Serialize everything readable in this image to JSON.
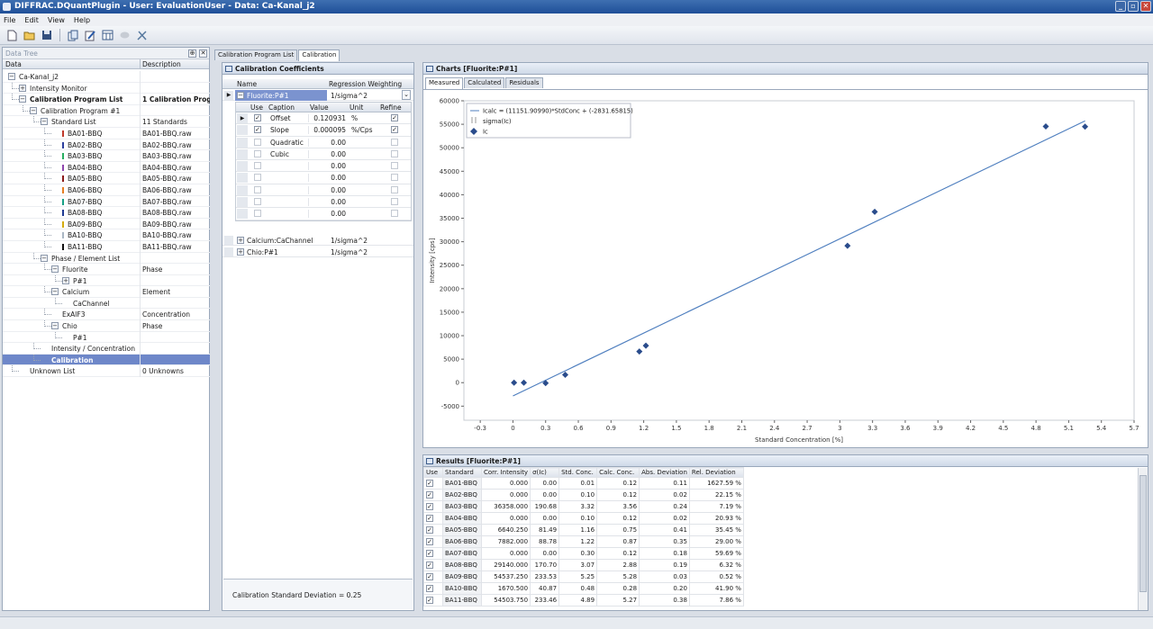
{
  "window": {
    "title": "DIFFRAC.DQuantPlugin - User: EvaluationUser - Data: Ca-Kanal_j2"
  },
  "menu": [
    "File",
    "Edit",
    "View",
    "Help"
  ],
  "toolbar_icons": [
    "new-file-icon",
    "open-folder-icon",
    "save-icon",
    "copy-icon",
    "edit-icon",
    "table-icon",
    "disabled-icon",
    "settings-icon"
  ],
  "data_tree": {
    "title": "Data Tree",
    "col_data": "Data",
    "col_desc": "Description",
    "rows": [
      {
        "label": "Ca-Kanal_j2",
        "desc": "",
        "level": 0,
        "expander": "-",
        "bold": false,
        "swatch": ""
      },
      {
        "label": "Intensity Monitor",
        "desc": "",
        "level": 1,
        "expander": "+",
        "bold": false,
        "swatch": ""
      },
      {
        "label": "Calibration Program List",
        "desc": "1 Calibration Prog...",
        "level": 1,
        "expander": "-",
        "bold": true,
        "swatch": ""
      },
      {
        "label": "Calibration Program #1",
        "desc": "",
        "level": 2,
        "expander": "-",
        "bold": false,
        "swatch": ""
      },
      {
        "label": "Standard List",
        "desc": "11 Standards",
        "level": 3,
        "expander": "-",
        "bold": false,
        "swatch": ""
      },
      {
        "label": "BA01-BBQ",
        "desc": "BA01-BBQ.raw",
        "level": 4,
        "expander": "",
        "bold": false,
        "swatch": "#c0392b"
      },
      {
        "label": "BA02-BBQ",
        "desc": "BA02-BBQ.raw",
        "level": 4,
        "expander": "",
        "bold": false,
        "swatch": "#2c3e9e"
      },
      {
        "label": "BA03-BBQ",
        "desc": "BA03-BBQ.raw",
        "level": 4,
        "expander": "",
        "bold": false,
        "swatch": "#27ae60"
      },
      {
        "label": "BA04-BBQ",
        "desc": "BA04-BBQ.raw",
        "level": 4,
        "expander": "",
        "bold": false,
        "swatch": "#8e44ad"
      },
      {
        "label": "BA05-BBQ",
        "desc": "BA05-BBQ.raw",
        "level": 4,
        "expander": "",
        "bold": false,
        "swatch": "#8b1a1a"
      },
      {
        "label": "BA06-BBQ",
        "desc": "BA06-BBQ.raw",
        "level": 4,
        "expander": "",
        "bold": false,
        "swatch": "#e67e22"
      },
      {
        "label": "BA07-BBQ",
        "desc": "BA07-BBQ.raw",
        "level": 4,
        "expander": "",
        "bold": false,
        "swatch": "#16a085"
      },
      {
        "label": "BA08-BBQ",
        "desc": "BA08-BBQ.raw",
        "level": 4,
        "expander": "",
        "bold": false,
        "swatch": "#1f3a93"
      },
      {
        "label": "BA09-BBQ",
        "desc": "BA09-BBQ.raw",
        "level": 4,
        "expander": "",
        "bold": false,
        "swatch": "#d4ac0d"
      },
      {
        "label": "BA10-BBQ",
        "desc": "BA10-BBQ.raw",
        "level": 4,
        "expander": "",
        "bold": false,
        "swatch": "#aab7c4"
      },
      {
        "label": "BA11-BBQ",
        "desc": "BA11-BBQ.raw",
        "level": 4,
        "expander": "",
        "bold": false,
        "swatch": "#111111"
      },
      {
        "label": "Phase / Element List",
        "desc": "",
        "level": 3,
        "expander": "-",
        "bold": false,
        "swatch": ""
      },
      {
        "label": "Fluorite",
        "desc": "Phase",
        "level": 4,
        "expander": "-",
        "bold": false,
        "swatch": ""
      },
      {
        "label": "P#1",
        "desc": "",
        "level": 5,
        "expander": "+",
        "bold": false,
        "swatch": ""
      },
      {
        "label": "Calcium",
        "desc": "Element",
        "level": 4,
        "expander": "-",
        "bold": false,
        "swatch": ""
      },
      {
        "label": "CaChannel",
        "desc": "",
        "level": 5,
        "expander": "",
        "bold": false,
        "swatch": ""
      },
      {
        "label": "ExAlF3",
        "desc": "Concentration",
        "level": 4,
        "expander": "",
        "bold": false,
        "swatch": ""
      },
      {
        "label": "Chio",
        "desc": "Phase",
        "level": 4,
        "expander": "-",
        "bold": false,
        "swatch": ""
      },
      {
        "label": "P#1",
        "desc": "",
        "level": 5,
        "expander": "",
        "bold": false,
        "swatch": ""
      },
      {
        "label": "Intensity / Concentration",
        "desc": "",
        "level": 3,
        "expander": "",
        "bold": false,
        "swatch": ""
      },
      {
        "label": "Calibration",
        "desc": "",
        "level": 3,
        "expander": "",
        "bold": true,
        "swatch": "",
        "selected": true
      },
      {
        "label": "Unknown List",
        "desc": "0 Unknowns",
        "level": 1,
        "expander": "",
        "bold": false,
        "swatch": ""
      }
    ]
  },
  "doc_tabs": [
    "Calibration Program List",
    "Calibration"
  ],
  "coefficients": {
    "title": "Calibration Coefficients",
    "col_name": "Name",
    "col_weighting": "Regression Weighting",
    "groups": [
      {
        "name": "Fluorite:P#1",
        "weighting": "1/sigma^2"
      },
      {
        "name": "Calcium:CaChannel",
        "weighting": "1/sigma^2"
      },
      {
        "name": "Chio:P#1",
        "weighting": "1/sigma^2"
      }
    ],
    "sub_headers": [
      "Use",
      "Caption",
      "Value",
      "Unit",
      "Refine"
    ],
    "rows": [
      {
        "use": true,
        "caption": "Offset",
        "value": "0.120931",
        "unit": "%",
        "refine": true
      },
      {
        "use": true,
        "caption": "Slope",
        "value": "0.000095",
        "unit": "%/Cps",
        "refine": true
      },
      {
        "use": false,
        "caption": "Quadratic",
        "value": "0.00",
        "unit": "",
        "refine": false
      },
      {
        "use": false,
        "caption": "Cubic",
        "value": "0.00",
        "unit": "",
        "refine": false
      },
      {
        "use": false,
        "caption": "",
        "value": "0.00",
        "unit": "",
        "refine": false
      },
      {
        "use": false,
        "caption": "",
        "value": "0.00",
        "unit": "",
        "refine": false
      },
      {
        "use": false,
        "caption": "",
        "value": "0.00",
        "unit": "",
        "refine": false
      },
      {
        "use": false,
        "caption": "",
        "value": "0.00",
        "unit": "",
        "refine": false
      },
      {
        "use": false,
        "caption": "",
        "value": "0.00",
        "unit": "",
        "refine": false
      }
    ],
    "std_dev": "Calibration Standard Deviation = 0.25"
  },
  "charts": {
    "title": "Charts [Fluorite:P#1]",
    "tabs": [
      "Measured",
      "Calculated",
      "Residuals"
    ]
  },
  "chart_data": {
    "type": "scatter",
    "xlabel": "Standard Concentration [%]",
    "ylabel": "Intensity [cps]",
    "xlim": [
      -0.45,
      5.7
    ],
    "ylim": [
      -8000,
      60000
    ],
    "xticks": [
      "-0.3",
      "0",
      "0.3",
      "0.6",
      "0.9",
      "1.2",
      "1.5",
      "1.8",
      "2.1",
      "2.4",
      "2.7",
      "3",
      "3.3",
      "3.6",
      "3.9",
      "4.2",
      "4.5",
      "4.8",
      "5.1",
      "5.4",
      "5.7"
    ],
    "yticks": [
      "-5000",
      "0",
      "5000",
      "10000",
      "15000",
      "20000",
      "25000",
      "30000",
      "35000",
      "40000",
      "45000",
      "50000",
      "55000",
      "60000"
    ],
    "legend": {
      "position": "top-left",
      "entries": [
        "Icalc = (11151.90990)*StdConc + (-2831.65815)",
        "sigma(Ic)",
        "Ic"
      ]
    },
    "fit_line": {
      "slope": 11151.9099,
      "intercept": -2831.65815,
      "x": [
        0.0,
        5.25
      ]
    },
    "series": [
      {
        "name": "Ic",
        "x": [
          0.01,
          0.1,
          0.3,
          0.48,
          1.16,
          1.22,
          3.07,
          3.32,
          4.89,
          5.25
        ],
        "y": [
          0,
          0,
          -100,
          1670,
          6640,
          7882,
          29140,
          36358,
          54537,
          54504
        ]
      }
    ],
    "grid": true,
    "colors": {
      "line": "#4f7fbf",
      "marker": "#2a4c8c"
    }
  },
  "results": {
    "title": "Results [Fluorite:P#1]",
    "headers": [
      "Use",
      "Standard",
      "Corr. Intensity",
      "σ(Ic)",
      "Std. Conc.",
      "Calc. Conc.",
      "Abs. Deviation",
      "Rel. Deviation"
    ],
    "rows": [
      {
        "use": true,
        "standard": "BA01-BBQ",
        "corr": "0.000",
        "sigma": "0.00",
        "std": "0.01",
        "calc": "0.12",
        "abs": "0.11",
        "rel": "1627.59 %"
      },
      {
        "use": true,
        "standard": "BA02-BBQ",
        "corr": "0.000",
        "sigma": "0.00",
        "std": "0.10",
        "calc": "0.12",
        "abs": "0.02",
        "rel": "22.15 %"
      },
      {
        "use": true,
        "standard": "BA03-BBQ",
        "corr": "36358.000",
        "sigma": "190.68",
        "std": "3.32",
        "calc": "3.56",
        "abs": "0.24",
        "rel": "7.19 %"
      },
      {
        "use": true,
        "standard": "BA04-BBQ",
        "corr": "0.000",
        "sigma": "0.00",
        "std": "0.10",
        "calc": "0.12",
        "abs": "0.02",
        "rel": "20.93 %"
      },
      {
        "use": true,
        "standard": "BA05-BBQ",
        "corr": "6640.250",
        "sigma": "81.49",
        "std": "1.16",
        "calc": "0.75",
        "abs": "0.41",
        "rel": "35.45 %"
      },
      {
        "use": true,
        "standard": "BA06-BBQ",
        "corr": "7882.000",
        "sigma": "88.78",
        "std": "1.22",
        "calc": "0.87",
        "abs": "0.35",
        "rel": "29.00 %"
      },
      {
        "use": true,
        "standard": "BA07-BBQ",
        "corr": "0.000",
        "sigma": "0.00",
        "std": "0.30",
        "calc": "0.12",
        "abs": "0.18",
        "rel": "59.69 %"
      },
      {
        "use": true,
        "standard": "BA08-BBQ",
        "corr": "29140.000",
        "sigma": "170.70",
        "std": "3.07",
        "calc": "2.88",
        "abs": "0.19",
        "rel": "6.32 %"
      },
      {
        "use": true,
        "standard": "BA09-BBQ",
        "corr": "54537.250",
        "sigma": "233.53",
        "std": "5.25",
        "calc": "5.28",
        "abs": "0.03",
        "rel": "0.52 %"
      },
      {
        "use": true,
        "standard": "BA10-BBQ",
        "corr": "1670.500",
        "sigma": "40.87",
        "std": "0.48",
        "calc": "0.28",
        "abs": "0.20",
        "rel": "41.90 %"
      },
      {
        "use": true,
        "standard": "BA11-BBQ",
        "corr": "54503.750",
        "sigma": "233.46",
        "std": "4.89",
        "calc": "5.27",
        "abs": "0.38",
        "rel": "7.86 %"
      }
    ]
  }
}
